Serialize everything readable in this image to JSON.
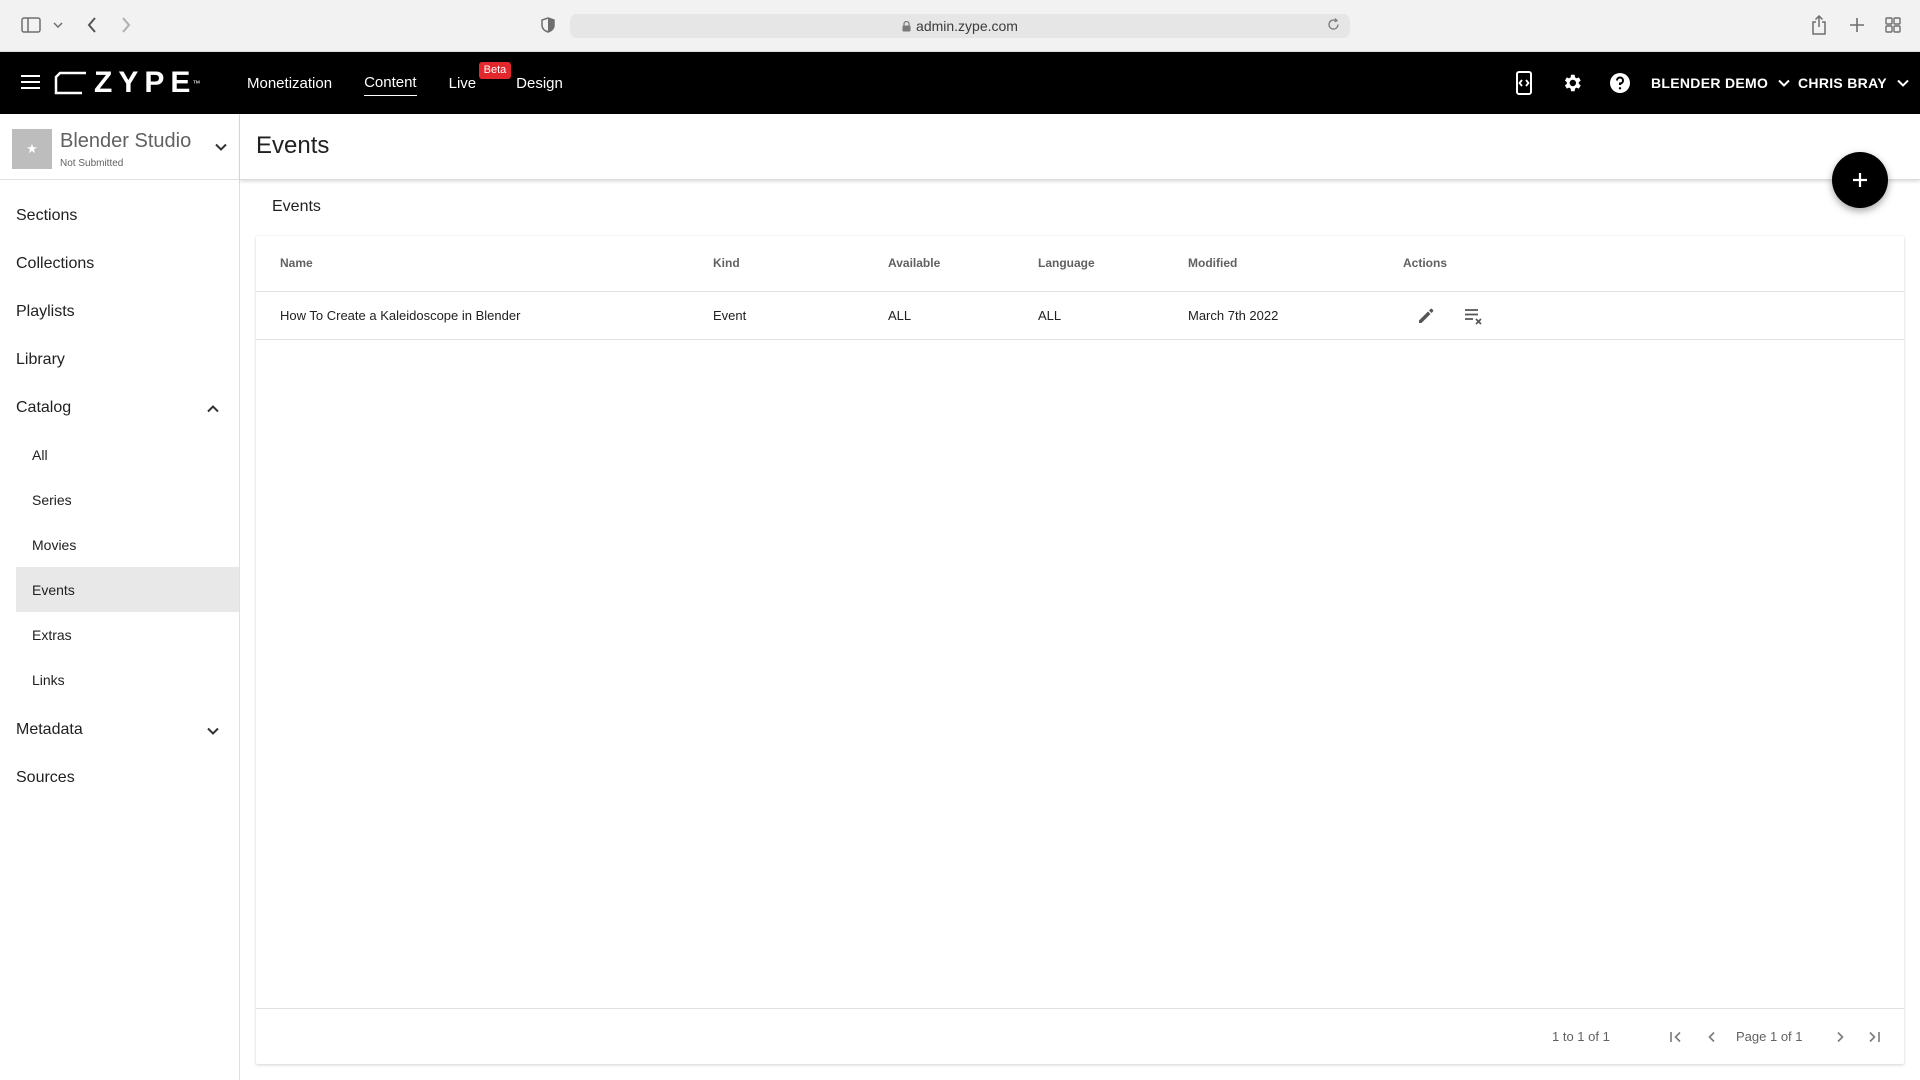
{
  "browser": {
    "url": "admin.zype.com"
  },
  "header": {
    "logo_text": "ZYPE",
    "logo_tm": "™",
    "nav": [
      {
        "label": "Monetization"
      },
      {
        "label": "Content"
      },
      {
        "label": "Live"
      },
      {
        "label": "Design"
      }
    ],
    "beta_label": "Beta",
    "account_label": "BLENDER DEMO",
    "user_label": "CHRIS BRAY"
  },
  "sidebar": {
    "project_name": "Blender Studio",
    "project_status": "Not Submitted",
    "items": [
      {
        "label": "Sections"
      },
      {
        "label": "Collections"
      },
      {
        "label": "Playlists"
      },
      {
        "label": "Library"
      },
      {
        "label": "Catalog"
      }
    ],
    "catalog_items": [
      {
        "label": "All"
      },
      {
        "label": "Series"
      },
      {
        "label": "Movies"
      },
      {
        "label": "Events"
      },
      {
        "label": "Extras"
      },
      {
        "label": "Links"
      }
    ],
    "bottom_items": [
      {
        "label": "Metadata"
      },
      {
        "label": "Sources"
      }
    ]
  },
  "main": {
    "page_title": "Events",
    "section_label": "Events",
    "table": {
      "columns": [
        "Name",
        "Kind",
        "Available",
        "Language",
        "Modified",
        "Actions"
      ],
      "rows": [
        {
          "name": "How To Create a Kaleidoscope in Blender",
          "kind": "Event",
          "available": "ALL",
          "language": "ALL",
          "modified": "March 7th 2022"
        }
      ]
    },
    "pagination": {
      "range": "1 to 1 of 1",
      "page": "Page 1 of 1"
    }
  }
}
